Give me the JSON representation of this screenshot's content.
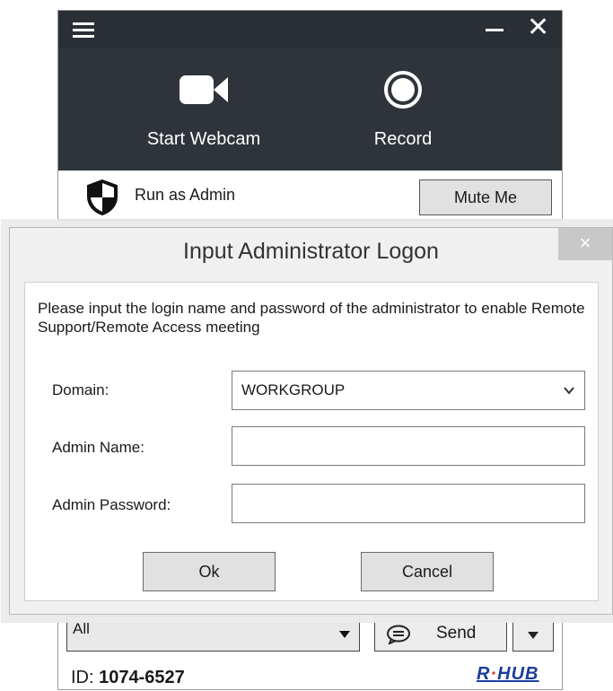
{
  "app": {
    "start_webcam_label": "Start Webcam",
    "record_label": "Record",
    "run_as_admin_label": "Run as Admin",
    "mute_label": "Mute Me",
    "chat_target": "All",
    "send_label": "Send",
    "id_prefix": "ID:",
    "id_value": "1074-6527",
    "brand_r": "R",
    "brand_dot": "·",
    "brand_hub": "HUB"
  },
  "dialog": {
    "title": "Input Administrator Logon",
    "close_glyph": "×",
    "message": "Please input the login name and password of the administrator to enable Remote Support/Remote Access meeting",
    "domain_label": "Domain:",
    "domain_value": "WORKGROUP",
    "admin_name_label": "Admin Name:",
    "admin_name_value": "",
    "admin_password_label": "Admin Password:",
    "admin_password_value": "",
    "ok_label": "Ok",
    "cancel_label": "Cancel"
  },
  "colors": {
    "titlebar": "#2a2f36",
    "toolbar": "#2f343b",
    "brand": "#1a3d9e"
  },
  "icons": [
    "menu-icon",
    "minimize-icon",
    "close-icon",
    "webcam-icon",
    "record-icon",
    "shield-icon",
    "chat-icon",
    "dropdown-arrow-icon",
    "chevron-down-icon"
  ]
}
